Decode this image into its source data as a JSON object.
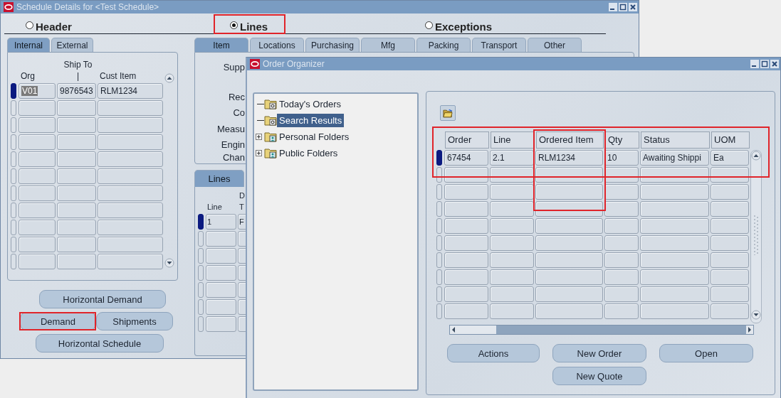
{
  "schedule_window": {
    "title": "Schedule Details for <Test Schedule>",
    "regions": [
      {
        "label": "Header",
        "selected": false
      },
      {
        "label": "Lines",
        "selected": true
      },
      {
        "label": "Exceptions",
        "selected": false
      }
    ],
    "left_tabs": [
      {
        "label": "Internal",
        "selected": true
      },
      {
        "label": "External",
        "selected": false
      }
    ],
    "left_table": {
      "columns": [
        {
          "lines": [
            "Org"
          ]
        },
        {
          "lines": [
            "Ship To",
            "|"
          ]
        },
        {
          "lines": [
            "Cust Item"
          ]
        }
      ],
      "rows": [
        {
          "current": true,
          "cells": [
            {
              "text": "V01",
              "highlighted": true
            },
            {
              "text": "9876543",
              "highlighted": false
            },
            {
              "text": "RLM1234",
              "highlighted": false
            }
          ]
        }
      ]
    },
    "buttons": [
      "Horizontal Demand",
      "Demand",
      "Shipments",
      "Horizontal Schedule"
    ],
    "line_tabs": [
      {
        "label": "Item",
        "selected": true
      },
      {
        "label": "Locations",
        "selected": false
      },
      {
        "label": "Purchasing",
        "selected": false
      },
      {
        "label": "Mfg",
        "selected": false
      },
      {
        "label": "Packing",
        "selected": false
      },
      {
        "label": "Transport",
        "selected": false
      },
      {
        "label": "Other",
        "selected": false
      }
    ],
    "item_labels": [
      "Supp",
      "Rec",
      "Co",
      "Measu",
      "Engin",
      "Chan"
    ],
    "lines_tab": {
      "label": "Lines",
      "selected": true
    },
    "lines_table": {
      "columns": [
        {
          "lines": [
            "Line"
          ]
        },
        {
          "lines": [
            "D",
            "T"
          ]
        }
      ],
      "rows": [
        {
          "current": true,
          "cells": [
            {
              "text": "1",
              "highlighted": false
            },
            {
              "text": "F",
              "highlighted": false
            }
          ]
        }
      ]
    }
  },
  "order_organizer": {
    "title": "Order Organizer",
    "tree": [
      {
        "label": "Today's Orders",
        "selected": false,
        "has_children": false
      },
      {
        "label": "Search Results",
        "selected": true,
        "has_children": false
      },
      {
        "label": "Personal Folders",
        "selected": false,
        "has_children": true
      },
      {
        "label": "Public Folders",
        "selected": false,
        "has_children": true
      }
    ],
    "table": {
      "columns": [
        "Order",
        "Line",
        "Ordered Item",
        "Qty",
        "Status",
        "UOM"
      ],
      "rows": [
        {
          "current": true,
          "cells": [
            "67454",
            "2.1",
            "RLM1234",
            "10",
            "Awaiting Shippi",
            "Ea"
          ]
        }
      ]
    },
    "buttons": [
      "Actions",
      "New Order",
      "Open",
      "New Quote"
    ]
  }
}
